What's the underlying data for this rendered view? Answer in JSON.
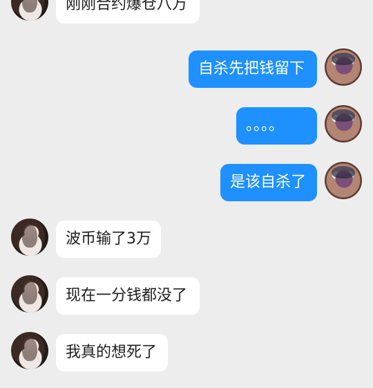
{
  "messages": [
    {
      "side": "left",
      "text": "刚刚合约爆仓八万"
    },
    {
      "side": "right",
      "text": "自杀先把钱留下"
    },
    {
      "side": "right",
      "text": "。。。。"
    },
    {
      "side": "right",
      "text": "是该自杀了"
    },
    {
      "side": "left",
      "text": "波币输了3万"
    },
    {
      "side": "left",
      "text": "现在一分钱都没了"
    },
    {
      "side": "left",
      "text": "我真的想死了"
    }
  ]
}
